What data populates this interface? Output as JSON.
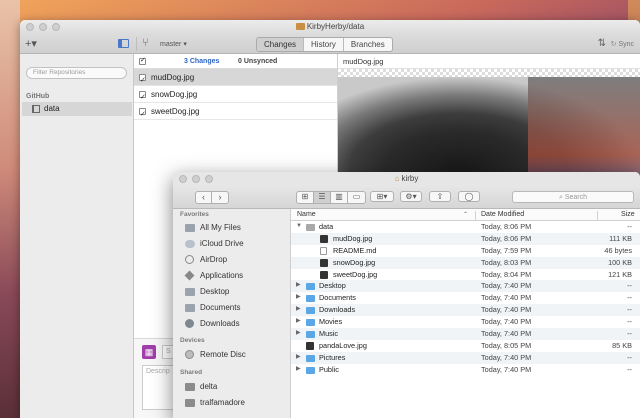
{
  "github_window": {
    "title": "KirbyHerby/data",
    "toolbar": {
      "add_label": "+▾",
      "branch": "master ▾",
      "tabs": [
        {
          "label": "Changes",
          "active": true
        },
        {
          "label": "History",
          "active": false
        },
        {
          "label": "Branches",
          "active": false
        }
      ],
      "sync_label": "Sync"
    },
    "sidebar": {
      "filter_placeholder": "Filter Repositories",
      "section": "GitHub",
      "repos": [
        {
          "label": "data",
          "selected": true
        }
      ]
    },
    "changes": {
      "count_label": "3 Changes",
      "unsynced_label": "0 Unsynced",
      "files": [
        {
          "name": "mudDog.jpg",
          "checked": true,
          "selected": true
        },
        {
          "name": "snowDog.jpg",
          "checked": true,
          "selected": false
        },
        {
          "name": "sweetDog.jpg",
          "checked": true,
          "selected": false
        }
      ],
      "summary_placeholder": "S",
      "description_placeholder": "Descrip"
    },
    "diff": {
      "filename": "mudDog.jpg"
    }
  },
  "finder_window": {
    "title": "kirby",
    "search_placeholder": "Search",
    "sidebar": {
      "favorites_label": "Favorites",
      "favorites": [
        {
          "label": "All My Files",
          "icon": "files-icon"
        },
        {
          "label": "iCloud Drive",
          "icon": "cloud-icon"
        },
        {
          "label": "AirDrop",
          "icon": "airdrop-icon"
        },
        {
          "label": "Applications",
          "icon": "applications-icon"
        },
        {
          "label": "Desktop",
          "icon": "folder-icon"
        },
        {
          "label": "Documents",
          "icon": "folder-icon"
        },
        {
          "label": "Downloads",
          "icon": "downloads-icon"
        }
      ],
      "devices_label": "Devices",
      "devices": [
        {
          "label": "Remote Disc",
          "icon": "disc-icon"
        }
      ],
      "shared_label": "Shared",
      "shared": [
        {
          "label": "delta",
          "icon": "monitor-icon"
        },
        {
          "label": "tralfamadore",
          "icon": "monitor-icon"
        }
      ]
    },
    "columns": {
      "name": "Name",
      "date": "Date Modified",
      "size": "Size"
    },
    "rows": [
      {
        "name": "data",
        "date": "Today, 8:06 PM",
        "size": "--",
        "kind": "folder-gray",
        "level": 0,
        "expanded": true
      },
      {
        "name": "mudDog.jpg",
        "date": "Today, 8:06 PM",
        "size": "111 KB",
        "kind": "image",
        "level": 1
      },
      {
        "name": "README.md",
        "date": "Today, 7:59 PM",
        "size": "46 bytes",
        "kind": "doc",
        "level": 1
      },
      {
        "name": "snowDog.jpg",
        "date": "Today, 8:03 PM",
        "size": "100 KB",
        "kind": "image",
        "level": 1
      },
      {
        "name": "sweetDog.jpg",
        "date": "Today, 8:04 PM",
        "size": "121 KB",
        "kind": "image",
        "level": 1
      },
      {
        "name": "Desktop",
        "date": "Today, 7:40 PM",
        "size": "--",
        "kind": "folder",
        "level": 0
      },
      {
        "name": "Documents",
        "date": "Today, 7:40 PM",
        "size": "--",
        "kind": "folder",
        "level": 0
      },
      {
        "name": "Downloads",
        "date": "Today, 7:40 PM",
        "size": "--",
        "kind": "folder",
        "level": 0
      },
      {
        "name": "Movies",
        "date": "Today, 7:40 PM",
        "size": "--",
        "kind": "folder",
        "level": 0
      },
      {
        "name": "Music",
        "date": "Today, 7:40 PM",
        "size": "--",
        "kind": "folder",
        "level": 0
      },
      {
        "name": "pandaLove.jpg",
        "date": "Today, 8:05 PM",
        "size": "85 KB",
        "kind": "image",
        "level": 0,
        "no_disclosure": true
      },
      {
        "name": "Pictures",
        "date": "Today, 7:40 PM",
        "size": "--",
        "kind": "folder",
        "level": 0
      },
      {
        "name": "Public",
        "date": "Today, 7:40 PM",
        "size": "--",
        "kind": "folder",
        "level": 0
      }
    ]
  }
}
